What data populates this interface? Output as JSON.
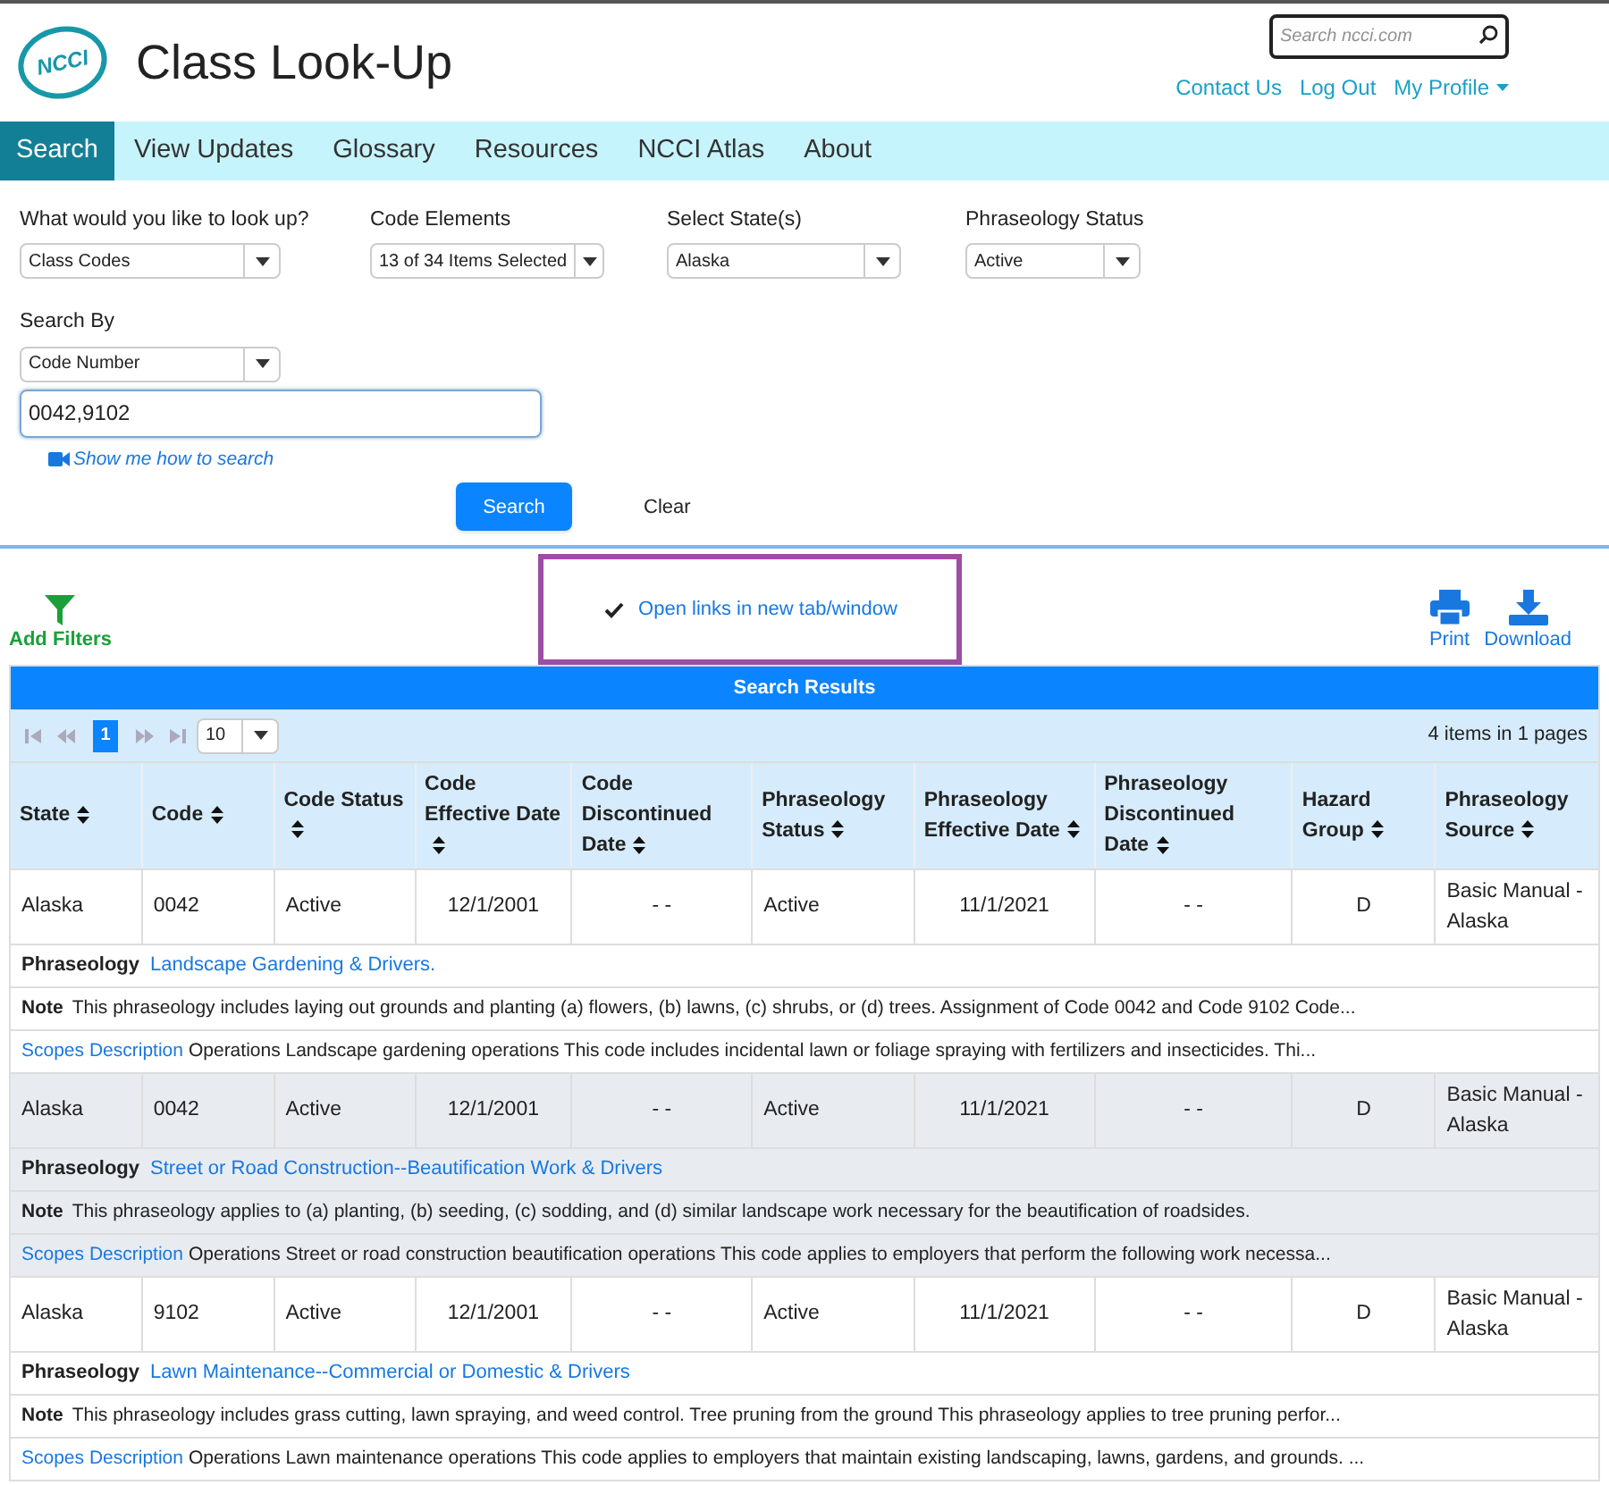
{
  "header": {
    "logo_text": "NCCI",
    "title": "Class Look-Up",
    "search": {
      "placeholder": "Search ncci.com"
    },
    "links": [
      "Contact Us",
      "Log Out",
      "My Profile"
    ]
  },
  "nav": [
    {
      "label": "Search",
      "selected": true
    },
    {
      "label": "View Updates",
      "selected": false
    },
    {
      "label": "Glossary",
      "selected": false
    },
    {
      "label": "Resources",
      "selected": false
    },
    {
      "label": "NCCI Atlas",
      "selected": false
    },
    {
      "label": "About",
      "selected": false
    }
  ],
  "form": {
    "selects": [
      {
        "label": "What would you like to look up?",
        "value": "Class Codes"
      },
      {
        "label": "Code Elements",
        "value": "13 of 34 Items Selected"
      },
      {
        "label": "Select State(s)",
        "value": "Alaska"
      },
      {
        "label": "Phraseology Status",
        "value": "Active"
      }
    ],
    "search_by": {
      "label": "Search By",
      "value": "Code Number"
    },
    "query": "0042,9102",
    "help_link": "Show me how to search",
    "buttons": [
      "Search",
      "Clear"
    ]
  },
  "toolbar": {
    "add_filters": "Add Filters",
    "open_links": {
      "label": "Open links in new tab/window",
      "checked": true
    },
    "print": "Print",
    "download": "Download"
  },
  "results": {
    "title": "Search Results",
    "pager": {
      "pages": [
        {
          "label": "1",
          "selected": true
        }
      ],
      "page_size": "10",
      "summary": "4 items in 1 pages"
    },
    "columns": [
      "State",
      "Code",
      "Code Status",
      "Code Effective Date",
      "Code Discontinued Date",
      "Phraseology Status",
      "Phraseology Effective Date",
      "Phraseology Discontinued Date",
      "Hazard Group",
      "Phraseology Source"
    ],
    "rows": [
      {
        "highlighted": false,
        "cells": [
          "Alaska",
          "0042",
          "Active",
          "12/1/2001",
          "- -",
          "Active",
          "11/1/2021",
          "- -",
          "D",
          "Basic Manual - Alaska"
        ],
        "phraseology_label": "Phraseology",
        "phraseology": "Landscape Gardening & Drivers.",
        "note_label": "Note",
        "note": "This phraseology includes laying out grounds and planting (a) flowers, (b) lawns, (c) shrubs, or (d) trees. Assignment of Code 0042 and Code 9102 Code...",
        "scopes_label": "Scopes Description",
        "scopes": "Operations Landscape gardening operations This code includes incidental lawn or foliage spraying with fertilizers and insecticides. Thi..."
      },
      {
        "highlighted": true,
        "cells": [
          "Alaska",
          "0042",
          "Active",
          "12/1/2001",
          "- -",
          "Active",
          "11/1/2021",
          "- -",
          "D",
          "Basic Manual - Alaska"
        ],
        "phraseology_label": "Phraseology",
        "phraseology": "Street or Road Construction--Beautification Work & Drivers",
        "note_label": "Note",
        "note": "This phraseology applies to (a) planting, (b) seeding, (c) sodding, and (d) similar landscape work necessary for the beautification of roadsides.",
        "scopes_label": "Scopes Description",
        "scopes": "Operations Street or road construction beautification operations This code applies to employers that perform the following work necessa..."
      },
      {
        "highlighted": false,
        "cells": [
          "Alaska",
          "9102",
          "Active",
          "12/1/2001",
          "- -",
          "Active",
          "11/1/2021",
          "- -",
          "D",
          "Basic Manual - Alaska"
        ],
        "phraseology_label": "Phraseology",
        "phraseology": "Lawn Maintenance--Commercial or Domestic & Drivers",
        "note_label": "Note",
        "note": "This phraseology includes grass cutting, lawn spraying, and weed control. Tree pruning from the ground This phraseology applies to tree pruning perfor...",
        "scopes_label": "Scopes Description",
        "scopes": "Operations Lawn maintenance operations This code applies to employers that maintain existing landscaping, lawns, gardens, and grounds. ..."
      }
    ]
  }
}
